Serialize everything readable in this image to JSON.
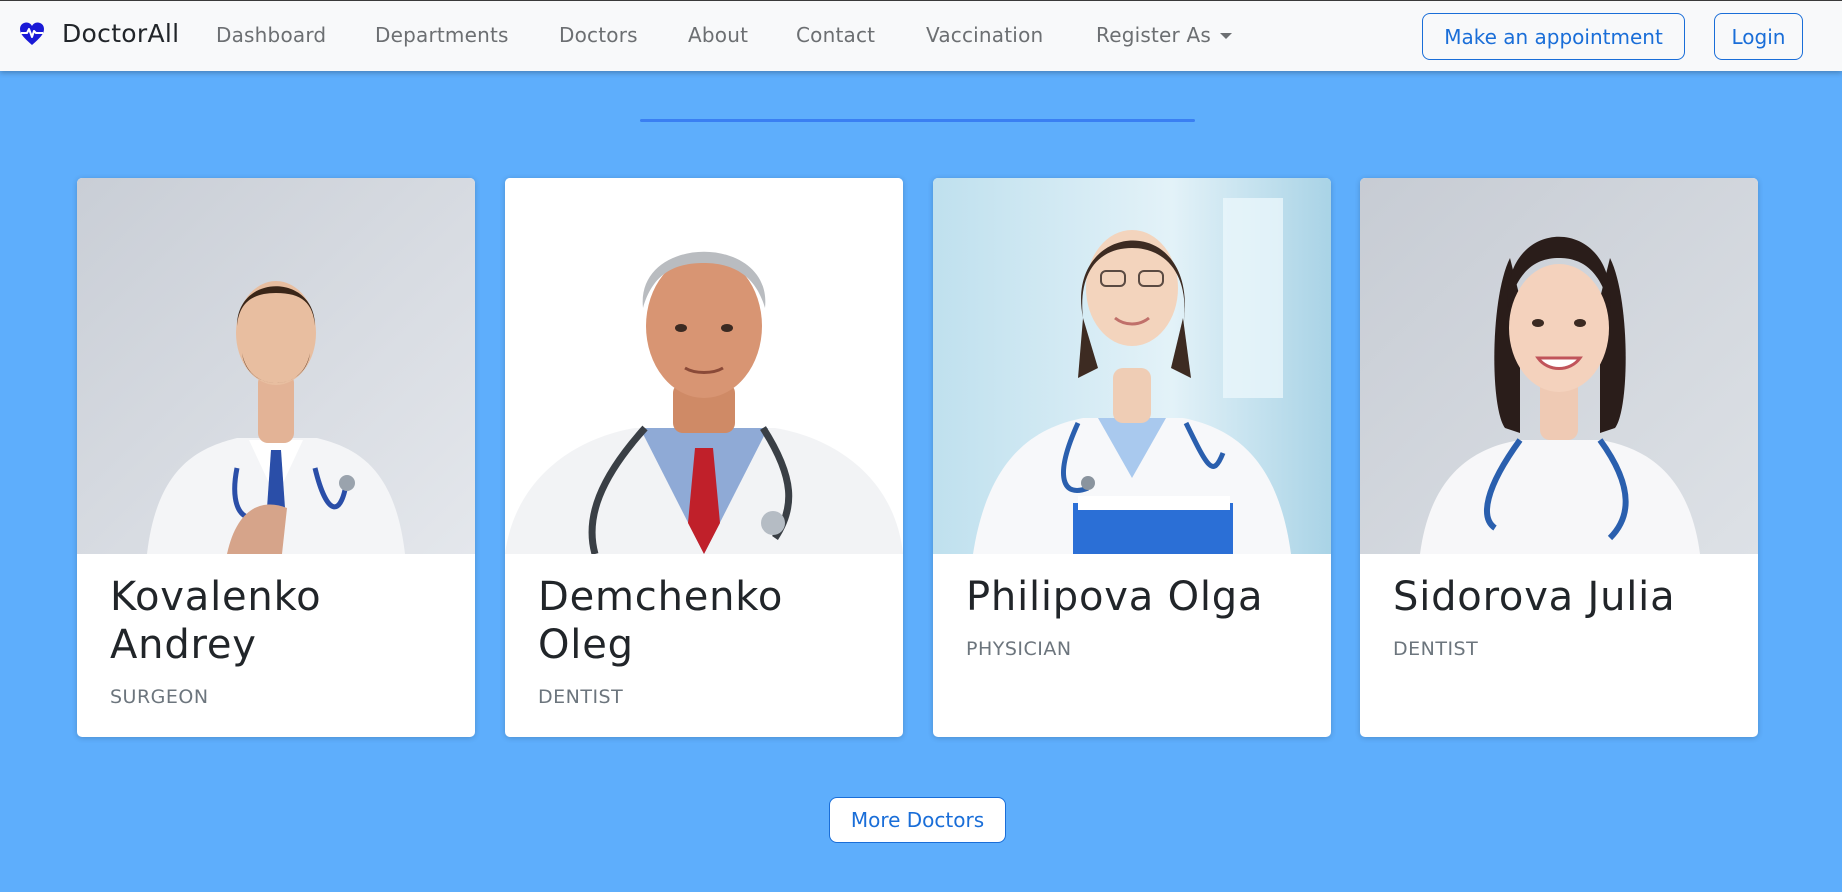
{
  "nav": {
    "brand": "DoctorAll",
    "links": {
      "dashboard": "Dashboard",
      "departments": "Departments",
      "doctors": "Doctors",
      "about": "About",
      "contact": "Contact",
      "vaccination": "Vaccination",
      "register": "Register As"
    },
    "appointment_label": "Make an appointment",
    "login_label": "Login"
  },
  "doctors": [
    {
      "name": "Kovalenko Andrey",
      "role": "SURGEON"
    },
    {
      "name": "Demchenko Oleg",
      "role": "DENTIST"
    },
    {
      "name": "Philipova Olga",
      "role": "PHYSICIAN"
    },
    {
      "name": "Sidorova Julia",
      "role": "DENTIST"
    }
  ],
  "more_label": "More Doctors",
  "colors": {
    "page_background": "#5eaefc",
    "accent": "#1a6ed8",
    "brand_icon": "#1a1ad6",
    "divider": "#3a7ff2"
  },
  "icons": {
    "brand": "heart-pulse-icon",
    "dropdown": "caret-down-icon"
  }
}
